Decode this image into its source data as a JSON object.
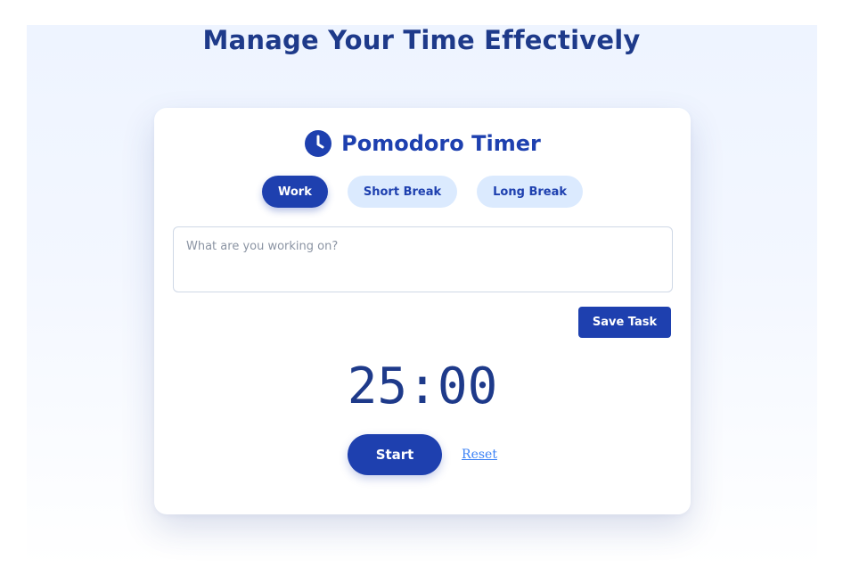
{
  "header": {
    "title": "Manage Your Time Effectively"
  },
  "timer_card": {
    "title": "Pomodoro Timer",
    "icon": "clock-icon",
    "modes": [
      {
        "label": "Work",
        "active": true
      },
      {
        "label": "Short Break",
        "active": false
      },
      {
        "label": "Long Break",
        "active": false
      }
    ],
    "task_input": {
      "placeholder": "What are you working on?",
      "value": ""
    },
    "save_label": "Save Task",
    "time_display": "25:00",
    "start_label": "Start",
    "reset_label": "Reset"
  },
  "colors": {
    "primary": "#1e40af",
    "heading": "#1e3a8a",
    "inactive_tab_bg": "#dbeafe",
    "link": "#3b82f6"
  }
}
